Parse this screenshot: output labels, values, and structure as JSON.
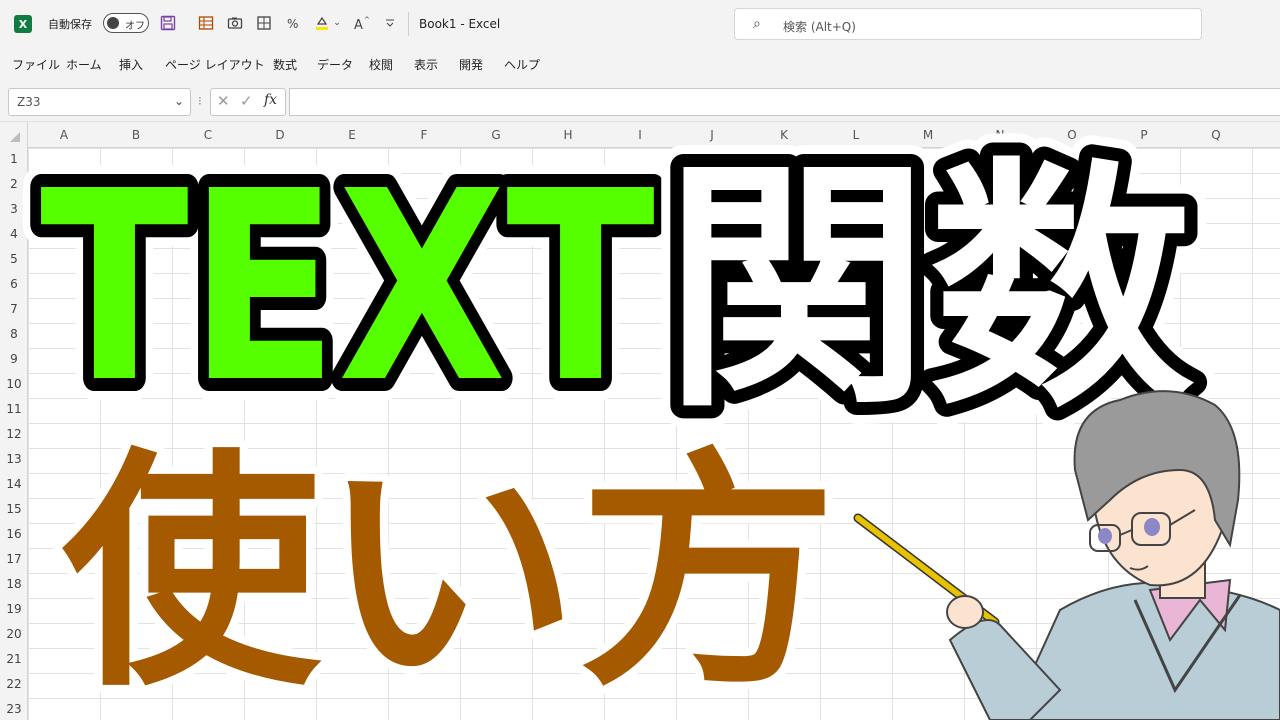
{
  "window": {
    "autosave_label": "自動保存",
    "autosave_state": "オフ",
    "doc_title": "Book1  -  Excel",
    "search_placeholder": "検索 (Alt+Q)"
  },
  "menu": [
    "ファイル",
    "ホーム",
    "挿入",
    "ページ レイアウト",
    "数式",
    "データ",
    "校閲",
    "表示",
    "開発",
    "ヘルプ"
  ],
  "formula_bar": {
    "name_box": "Z33",
    "fx_label": "fx",
    "value": ""
  },
  "sheet": {
    "columns": [
      "A",
      "B",
      "C",
      "D",
      "E",
      "F",
      "G",
      "H",
      "I",
      "J",
      "K",
      "L",
      "M",
      "N",
      "O",
      "P",
      "Q"
    ],
    "rows": [
      "1",
      "2",
      "3",
      "4",
      "5",
      "6",
      "7",
      "8",
      "9",
      "10",
      "11",
      "12",
      "13",
      "14",
      "15",
      "16",
      "17",
      "18",
      "19",
      "20",
      "21",
      "22",
      "23"
    ]
  },
  "overlay": {
    "title_latin": "TEXT",
    "title_kanji": "関数",
    "subtitle": "使い方",
    "colors": {
      "latin_fill": "#55ff00",
      "kanji_fill": "#ffffff",
      "outline": "#000000",
      "subtitle_fill": "#a65a00"
    }
  },
  "illustration": {
    "icon": "teacher-with-pointer-icon"
  }
}
